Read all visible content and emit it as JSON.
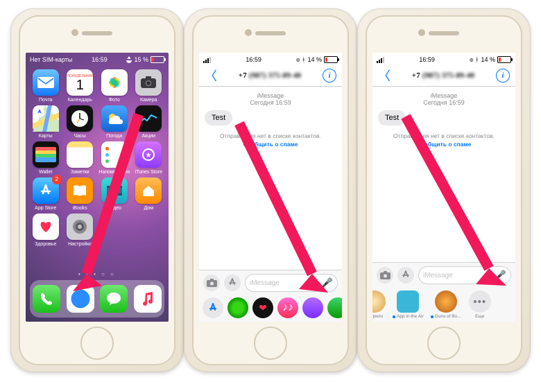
{
  "status": {
    "carrier": "Нет SIM-карты",
    "wifi": true,
    "time": "16:59",
    "bt": true,
    "battery": "14 %",
    "batt_alt": "15 %"
  },
  "home": {
    "apps": [
      {
        "label": "Почта",
        "color": "#fff"
      },
      {
        "label": "Календарь",
        "day": "1",
        "weekday": "ПОНЕДЕЛЬНИК"
      },
      {
        "label": "Фото"
      },
      {
        "label": "Камера"
      },
      {
        "label": "Карты"
      },
      {
        "label": "Часы"
      },
      {
        "label": "Погода"
      },
      {
        "label": "Акции"
      },
      {
        "label": "Wallet"
      },
      {
        "label": "Заметки"
      },
      {
        "label": "Напоминания"
      },
      {
        "label": "iTunes Store"
      },
      {
        "label": "App Store",
        "badge": "2"
      },
      {
        "label": "iBooks"
      },
      {
        "label": "Видео"
      },
      {
        "label": "Дом"
      },
      {
        "label": "Здоровье"
      },
      {
        "label": "Настройки"
      }
    ],
    "dock": [
      "Телефон",
      "Safari",
      "Сообщения",
      "Музыка"
    ]
  },
  "msg": {
    "contact_prefix": "+7",
    "contact_blur": "(987) 375-89-40",
    "service": "iMessage",
    "timeline": "Сегодня 16:59",
    "bubble": "Test",
    "spam1": "Отправителя нет в списке контактов.",
    "spam2": "Сообщить о спаме",
    "placeholder": "iMessage",
    "drawer2": [
      {
        "label": "…урило"
      },
      {
        "label": "App in the Air"
      },
      {
        "label": "Guns of Bo…"
      },
      {
        "label": "Еще"
      }
    ]
  }
}
